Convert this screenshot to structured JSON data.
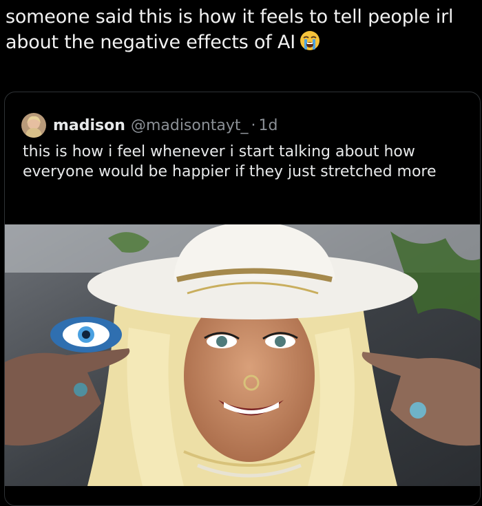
{
  "post": {
    "text_line1": "someone said this is how it feels to tell people irl",
    "text_line2": "about the negative effects of AI",
    "emoji": "loudly-crying-face-emoji"
  },
  "quoted_post": {
    "display_name": "madison",
    "handle": "@madisontayt_",
    "separator": "·",
    "time": "1d",
    "text": "this is how i feel whenever i start talking about how everyone would be happier if they just stretched more",
    "photo": "selfie-woman-white-hat-blonde-hair-pointing"
  },
  "colors": {
    "background": "#000000",
    "text": "#e7e9ea",
    "secondary_text": "#8b9096",
    "card_border": "#2f3336"
  }
}
